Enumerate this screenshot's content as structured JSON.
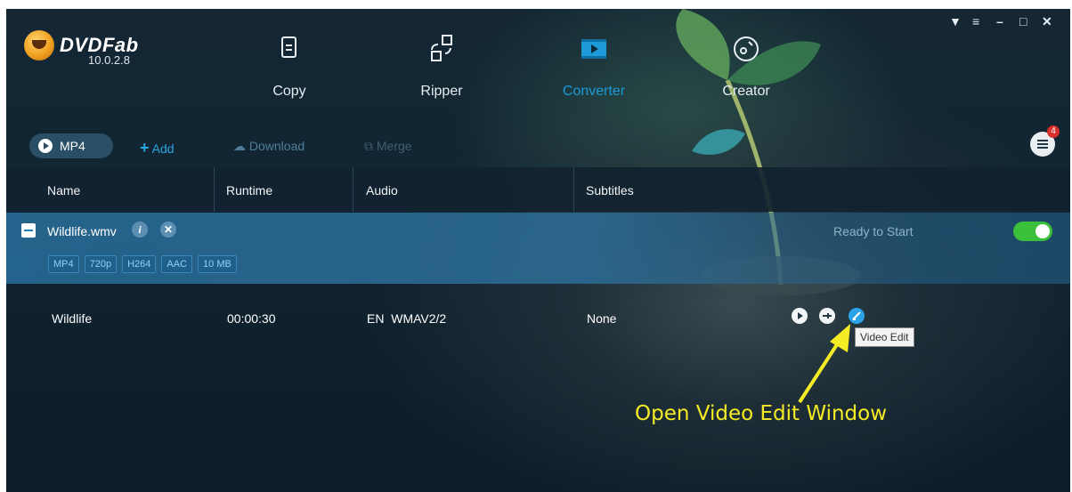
{
  "app": {
    "brand": "DVDFab",
    "version": "10.0.2.8",
    "window_controls": [
      "pin-icon",
      "menu-icon",
      "minimize-icon",
      "maximize-icon",
      "close-icon"
    ]
  },
  "modules": [
    {
      "label": "Copy",
      "icon": "copy-icon",
      "active": false
    },
    {
      "label": "Ripper",
      "icon": "ripper-icon",
      "active": false
    },
    {
      "label": "Converter",
      "icon": "converter-icon",
      "active": true
    },
    {
      "label": "Creator",
      "icon": "creator-icon",
      "active": false
    }
  ],
  "toolbar": {
    "profile": "MP4",
    "add": "Add",
    "download": "Download",
    "merge": "Merge",
    "task_count": "4"
  },
  "table": {
    "headers": [
      "Name",
      "Runtime",
      "Audio",
      "Subtitles"
    ]
  },
  "file": {
    "name": "Wildlife.wmv",
    "tags": [
      "MP4",
      "720p",
      "H264",
      "AAC",
      "10 MB"
    ],
    "status": "Ready to Start",
    "enabled": true,
    "title": {
      "name": "Wildlife",
      "runtime": "00:00:30",
      "audio": "EN  WMAV2/2",
      "subtitles": "None"
    }
  },
  "tooltip": "Video Edit",
  "annotation": "Open Video Edit Window",
  "colors": {
    "accent": "#1d9bd8",
    "toggle_on": "#3bc03b",
    "annotation": "#f5ec25"
  }
}
